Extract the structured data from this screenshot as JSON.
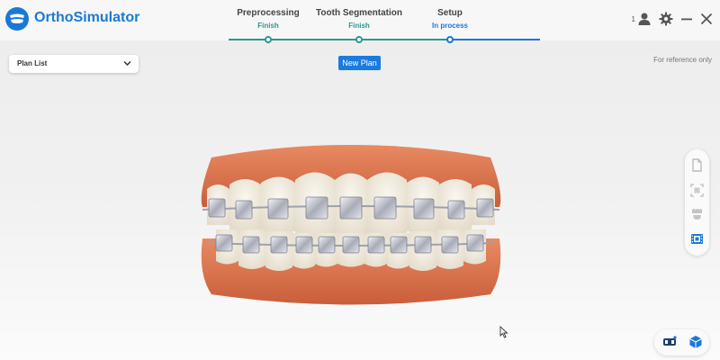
{
  "app": {
    "name": "OrthoSimulator"
  },
  "steps": [
    {
      "title": "Preprocessing",
      "status": "Finish",
      "state": "done"
    },
    {
      "title": "Tooth Segmentation",
      "status": "Finish",
      "state": "done"
    },
    {
      "title": "Setup",
      "status": "In process",
      "state": "active"
    }
  ],
  "header": {
    "user_count": "1"
  },
  "plan_list": {
    "label": "Plan List"
  },
  "new_plan": {
    "label": "New Plan"
  },
  "reference_note": "For reference only",
  "icons": {
    "header": [
      "user-icon",
      "gear-icon",
      "minimize-icon",
      "close-icon"
    ],
    "side_toolbar": [
      "document-icon",
      "scan-frame-icon",
      "teeth-icon",
      "film-view-icon"
    ],
    "view_toggle": [
      "braces-view-icon",
      "cube-view-icon"
    ]
  },
  "colors": {
    "brand": "#1a79d6",
    "finish": "#2a9a8e",
    "in_process": "#1a79d6",
    "gums": "#d9704a",
    "teeth": "#f3eee4"
  }
}
